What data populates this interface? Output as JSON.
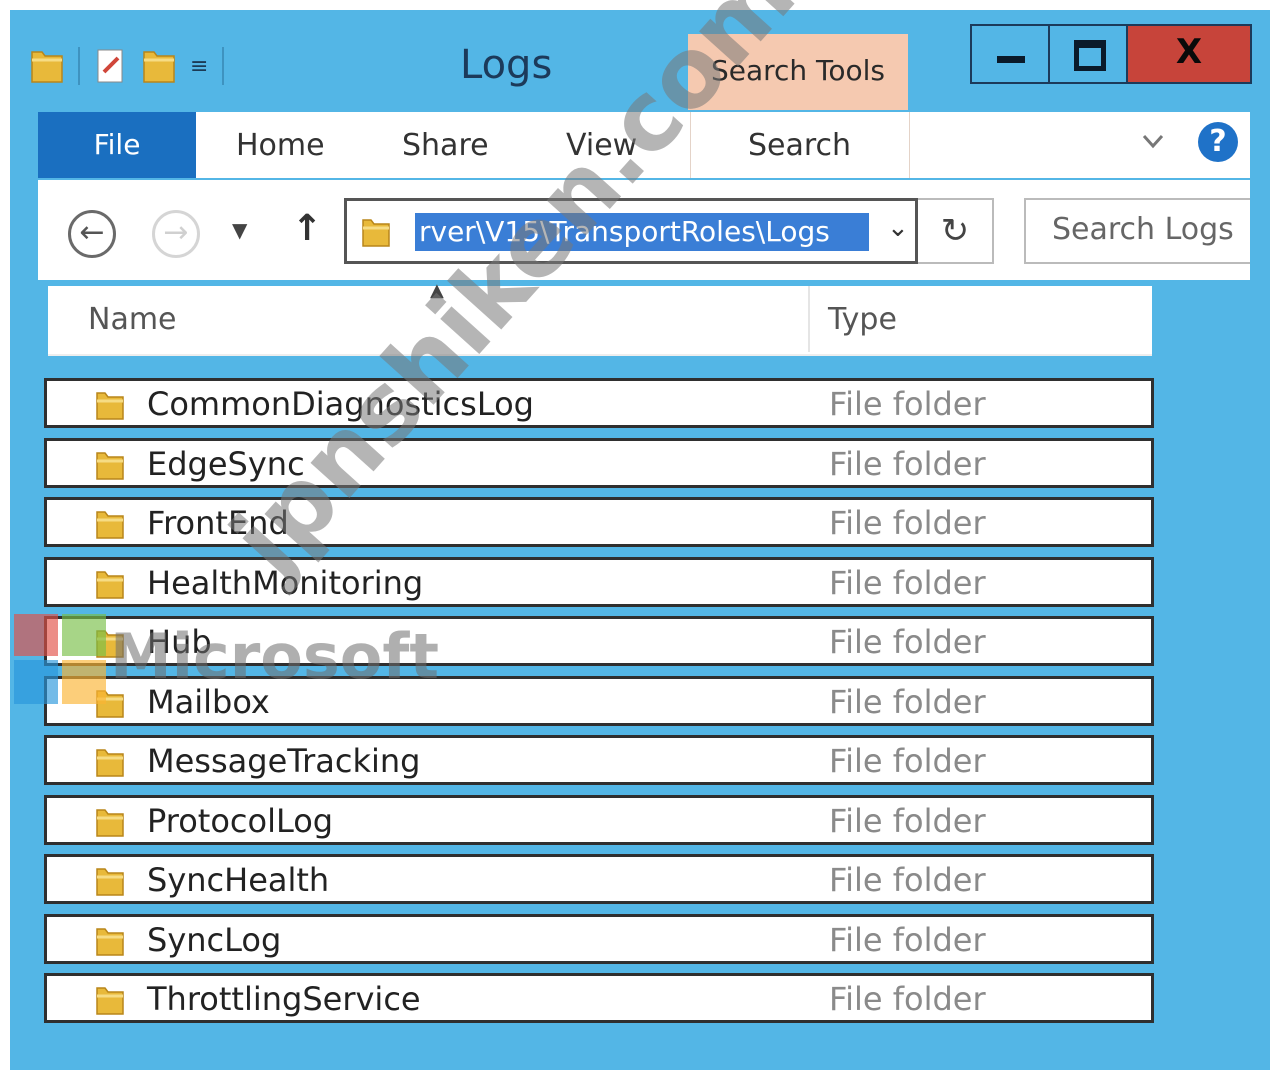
{
  "window": {
    "title": "Logs",
    "context_tab": "Search Tools",
    "close_label": "X",
    "accent_color": "#53b6e6"
  },
  "ribbon": {
    "tabs": [
      {
        "label": "File"
      },
      {
        "label": "Home"
      },
      {
        "label": "Share"
      },
      {
        "label": "View"
      },
      {
        "label": "Search"
      }
    ],
    "help_label": "?"
  },
  "nav": {
    "address_path": "rver\\V15\\TransportRoles\\Logs",
    "search_placeholder": "Search Logs"
  },
  "list": {
    "columns": {
      "name": "Name",
      "type": "Type"
    },
    "rows": [
      {
        "name": "CommonDiagnosticsLog",
        "type": "File folder"
      },
      {
        "name": "EdgeSync",
        "type": "File folder"
      },
      {
        "name": "FrontEnd",
        "type": "File folder"
      },
      {
        "name": "HealthMonitoring",
        "type": "File folder"
      },
      {
        "name": "Hub",
        "type": "File folder"
      },
      {
        "name": "Mailbox",
        "type": "File folder"
      },
      {
        "name": "MessageTracking",
        "type": "File folder"
      },
      {
        "name": "ProtocolLog",
        "type": "File folder"
      },
      {
        "name": "SyncHealth",
        "type": "File folder"
      },
      {
        "name": "SyncLog",
        "type": "File folder"
      },
      {
        "name": "ThrottlingService",
        "type": "File folder"
      }
    ]
  },
  "watermark": {
    "brand": "Microsoft",
    "site": "jpnshiken.com"
  }
}
